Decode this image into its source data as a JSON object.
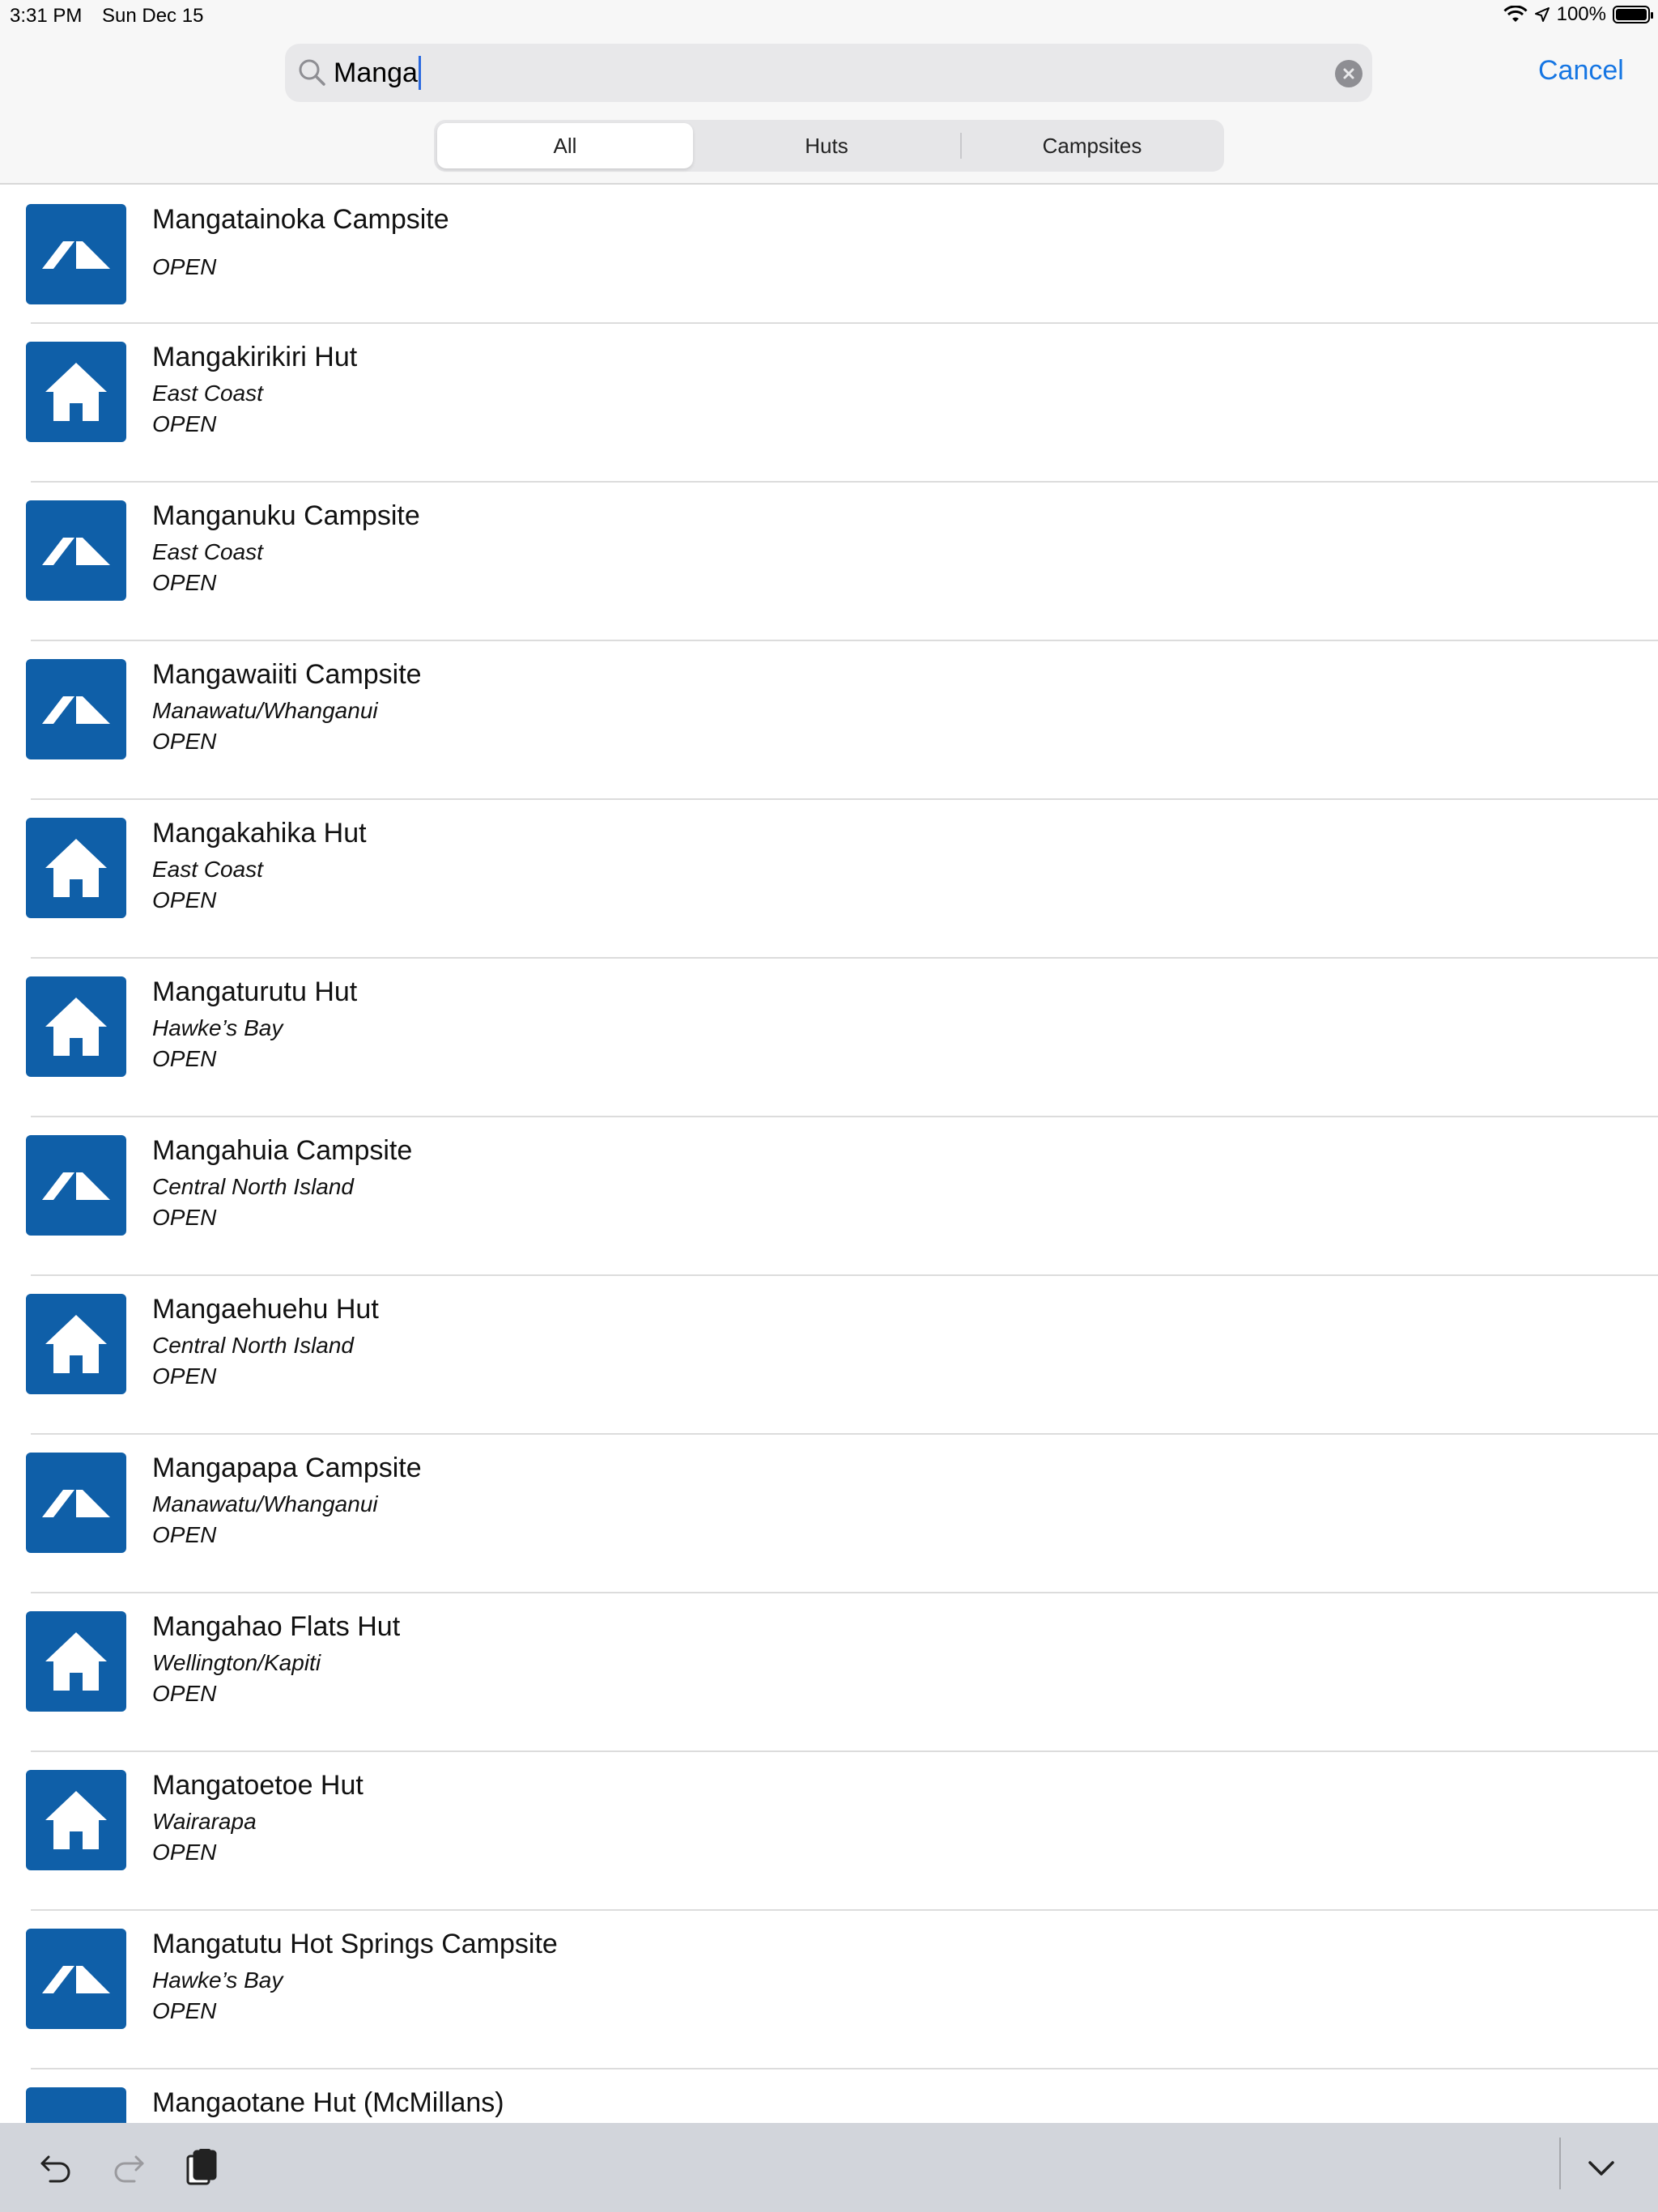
{
  "status_bar": {
    "time": "3:31 PM",
    "date": "Sun Dec 15",
    "battery": "100%"
  },
  "search": {
    "query": "Manga",
    "cancel_label": "Cancel"
  },
  "segments": [
    {
      "label": "All",
      "selected": true
    },
    {
      "label": "Huts",
      "selected": false
    },
    {
      "label": "Campsites",
      "selected": false
    }
  ],
  "results": [
    {
      "name": "Mangatainoka Campsite",
      "region": "",
      "status": "OPEN",
      "type": "campsite"
    },
    {
      "name": "Mangakirikiri Hut",
      "region": "East Coast",
      "status": "OPEN",
      "type": "hut"
    },
    {
      "name": "Manganuku Campsite",
      "region": "East Coast",
      "status": "OPEN",
      "type": "campsite"
    },
    {
      "name": "Mangawaiiti Campsite",
      "region": "Manawatu/Whanganui",
      "status": "OPEN",
      "type": "campsite"
    },
    {
      "name": "Mangakahika Hut",
      "region": "East Coast",
      "status": "OPEN",
      "type": "hut"
    },
    {
      "name": "Mangaturutu Hut",
      "region": "Hawke’s Bay",
      "status": "OPEN",
      "type": "hut"
    },
    {
      "name": "Mangahuia Campsite",
      "region": "Central North Island",
      "status": "OPEN",
      "type": "campsite"
    },
    {
      "name": "Mangaehuehu Hut",
      "region": "Central North Island",
      "status": "OPEN",
      "type": "hut"
    },
    {
      "name": "Mangapapa Campsite",
      "region": "Manawatu/Whanganui",
      "status": "OPEN",
      "type": "campsite"
    },
    {
      "name": "Mangahao Flats Hut",
      "region": "Wellington/Kapiti",
      "status": "OPEN",
      "type": "hut"
    },
    {
      "name": "Mangatoetoe Hut",
      "region": "Wairarapa",
      "status": "OPEN",
      "type": "hut"
    },
    {
      "name": "Mangatutu Hot Springs Campsite",
      "region": "Hawke’s Bay",
      "status": "OPEN",
      "type": "campsite"
    },
    {
      "name": "Mangaotane Hut (McMillans)",
      "region": "",
      "status": "",
      "type": "campsite"
    }
  ],
  "icons": {
    "hut": "hut-icon",
    "campsite": "tent-icon",
    "accent_color": "#0f5fa8",
    "link_color": "#1676e3"
  },
  "keyboard_bar": {
    "buttons": [
      "undo-icon",
      "redo-icon",
      "paste-icon",
      "dismiss-keyboard-icon"
    ]
  }
}
